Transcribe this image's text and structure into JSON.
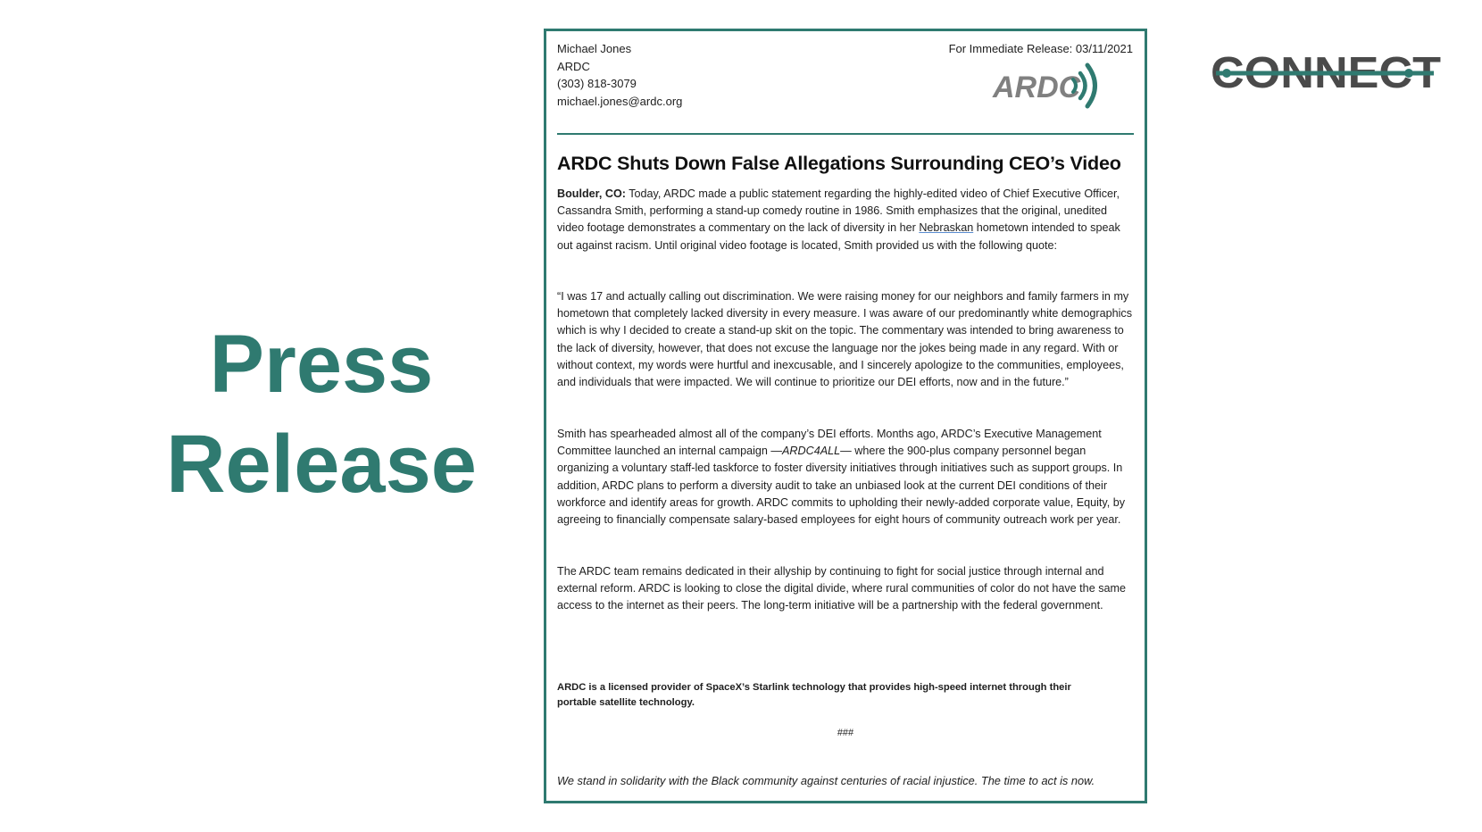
{
  "slide": {
    "title_line1": "Press",
    "title_line2": "Release",
    "logo_text": "CONNECT",
    "accent_color": "#2f7a70",
    "logo_color": "#4a4a4a"
  },
  "document": {
    "contact": {
      "name": "Michael Jones",
      "org": "ARDC",
      "phone": "(303) 818-3079",
      "email": "michael.jones@ardc.org"
    },
    "release_date": "For Immediate Release: 03/11/2021",
    "logo_text": "ARDC",
    "headline": "ARDC Shuts Down False Allegations Surrounding CEO’s Video",
    "p1_lead": "Boulder, CO:",
    "p1_text_a": " Today, ARDC made a public statement regarding the highly-edited video of Chief Executive Officer, Cassandra Smith, performing a stand-up comedy routine in 1986. Smith emphasizes that the original, unedited video footage demonstrates a commentary on the lack of diversity in her ",
    "p1_underlined": "Nebraskan",
    "p1_text_b": " hometown intended to speak out against racism. Until original video footage is located, Smith provided us with the following quote:",
    "p2": "“I was 17 and actually calling out discrimination. We were raising money for our neighbors and family farmers in my hometown that completely lacked diversity in every measure. I was aware of our predominantly white demographics which is why I decided to create a stand-up skit on the topic. The commentary was intended to bring awareness to the lack of diversity, however, that does not excuse the language nor the jokes being made in any regard. With or without context, my words were hurtful and inexcusable, and I sincerely apologize to the communities, employees, and individuals that were impacted. We will continue to prioritize our DEI efforts, now and in the future.”",
    "p3_a": "Smith has spearheaded almost all of the company’s DEI efforts. Months ago, ARDC’s Executive Management Committee launched an internal campaign ",
    "p3_campaign": "—ARDC4ALL—",
    "p3_b": " where the 900-plus company personnel began organizing a voluntary staff-led taskforce to foster diversity initiatives through initiatives such as support groups. In addition, ARDC plans to perform a diversity audit to take an unbiased look at the current DEI conditions of their workforce and identify areas for growth. ARDC commits to upholding their newly-added corporate value, Equity, by agreeing to financially compensate salary-based employees for eight hours of community outreach work per year.",
    "p4": "The ARDC team remains dedicated in their allyship by continuing to fight for social justice through internal and external reform. ARDC is looking to close the digital divide, where rural communities of color do not have the same access to the internet as their peers. The long-term initiative will be a partnership with the federal government.",
    "note": "ARDC is a licensed provider of SpaceX’s Starlink technology that provides high-speed internet through their portable satellite technology.",
    "end_mark": "###",
    "solidarity": "We stand in solidarity with the Black community against centuries of racial injustice. The time to act is now."
  }
}
